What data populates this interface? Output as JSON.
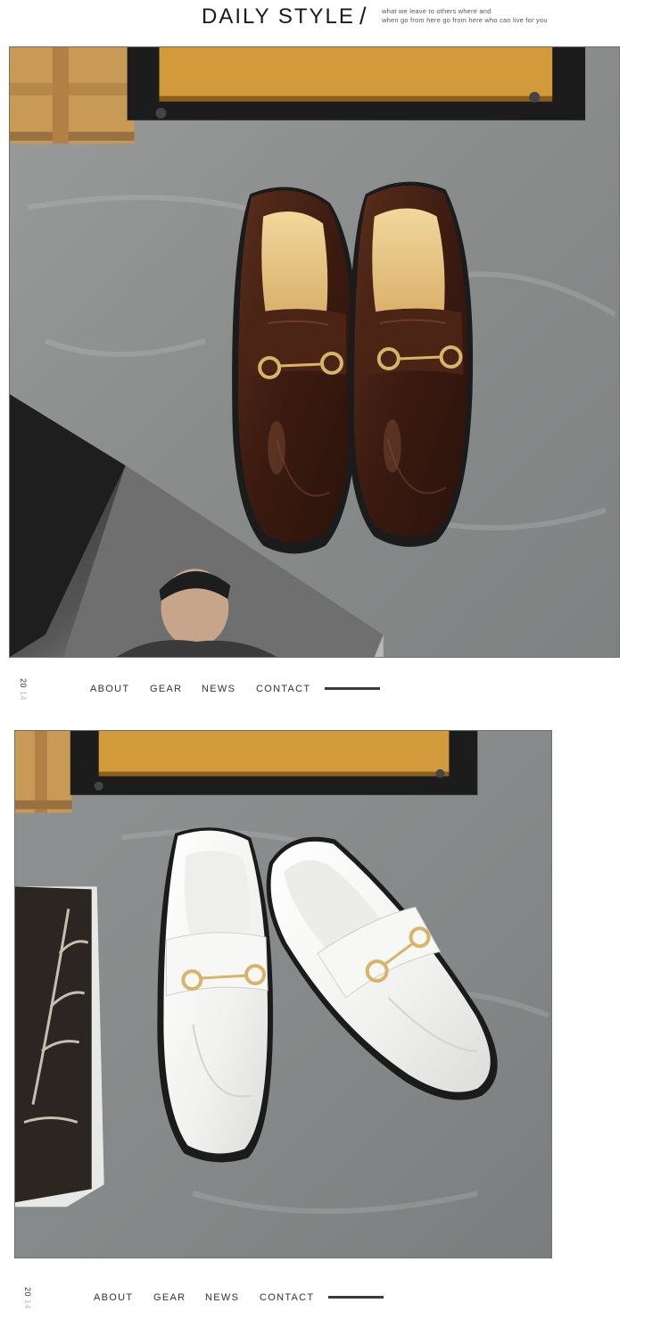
{
  "header": {
    "title": "DAILY STYLE",
    "slash": "/",
    "tagline_line1": "what we leave to others where and",
    "tagline_line2": "when go from here go from here who can live for you"
  },
  "nav": {
    "year_top": "20",
    "year_bottom": "14",
    "links": [
      "ABOUT",
      "GEAR",
      "NEWS",
      "CONTACT"
    ]
  },
  "photos": [
    {
      "subject": "brown leather horsebit loafers"
    },
    {
      "subject": "white leather horsebit loafers"
    }
  ],
  "colors": {
    "brown_leather": "#3e1e12",
    "white_leather": "#f4f4f2",
    "floor": "#8e9090",
    "wood": "#d39a3c",
    "hardware_gold": "#d8b36a"
  }
}
